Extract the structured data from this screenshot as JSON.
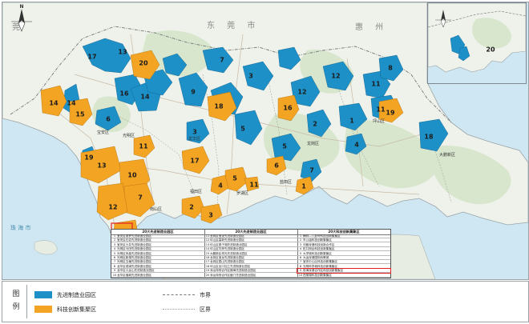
{
  "map": {
    "city_label_left": "深 圳 市",
    "city_label_top_left": "莞",
    "city_label_top_mid": "东 莞 市",
    "city_label_top_right": "惠 州",
    "sea_label": "珠 海 市",
    "north_label": "N",
    "colors": {
      "water": "#cfe7f2",
      "land": "#eef2ea",
      "hill": "#d8e6cd",
      "blue_zone": "#1e90c8",
      "orange_zone": "#f4a423",
      "road": "#c9b9a6",
      "boundary": "#777777"
    }
  },
  "zone_labels": {
    "blue": [
      "13",
      "17",
      "14",
      "16",
      "14",
      "16",
      "18",
      "5",
      "9",
      "3",
      "8",
      "11",
      "12",
      "19",
      "6",
      "7",
      "11",
      "1",
      "5",
      "18",
      "3",
      "12",
      "13",
      "4",
      "2",
      "7"
    ],
    "orange": [
      "20",
      "14",
      "15",
      "18",
      "16",
      "19",
      "13",
      "10",
      "7",
      "12",
      "17",
      "5",
      "4",
      "1",
      "2",
      "3",
      "11",
      "9",
      "6"
    ]
  },
  "inset": {
    "label": "20"
  },
  "place_labels": [
    "宝安区",
    "龙华区",
    "龙岗区",
    "坪山区",
    "大鹏新区",
    "南山区",
    "福田区",
    "罗湖区",
    "盐田区",
    "光明区"
  ],
  "table": {
    "col1_title": "20大先进制造业园区",
    "col2_title": "20大先进制造业园区",
    "col3_title": "20大科技创新集聚区",
    "col1_rows": [
      {
        "n": "1",
        "t": "宝安区燕罗先进制造业园区"
      },
      {
        "n": "2",
        "t": "宝安区石岩先进制造业园区"
      },
      {
        "n": "3",
        "t": "宝安区沙井先进制造业园区"
      },
      {
        "n": "4",
        "t": "光明区马田先进制造业园区"
      },
      {
        "n": "5",
        "t": "光明区凤凰先进制造业园区"
      },
      {
        "n": "6",
        "t": "光明区新湖先进制造业园区"
      },
      {
        "n": "7",
        "t": "光明区玉塘先进制造业园区"
      },
      {
        "n": "8",
        "t": "龙华区观澜先进制造业园区"
      },
      {
        "n": "9",
        "t": "龙华区九龙山先进制造业园区"
      },
      {
        "n": "10",
        "t": "龙华区福城先进制造业园区"
      }
    ],
    "col2_rows": [
      {
        "n": "11",
        "t": "龙岗区宝龙先进制造业园区"
      },
      {
        "n": "12",
        "t": "坪山区高新先进制造业园区"
      },
      {
        "n": "13",
        "t": "坪山区燕子湖先进制造业园区"
      },
      {
        "n": "14",
        "t": "坪山区坑梓先进制造业园区"
      },
      {
        "n": "15",
        "t": "大鹏新区坝光先进制造业园区"
      },
      {
        "n": "16",
        "t": "龙岗区宝龙先进制造业园区"
      },
      {
        "n": "17",
        "t": "龙岗区园山先进制造业园区"
      },
      {
        "n": "18",
        "t": "坪山区出口加工先进制造业园区"
      },
      {
        "n": "19",
        "t": "深汕特别合作区鹅埠先进制造业园区"
      },
      {
        "n": "20",
        "t": "深汕特别合作区鲘门先进制造业园区"
      }
    ],
    "col3_rows": [
      {
        "n": "1",
        "t": "梅林—八卦岭科技创新集聚区"
      },
      {
        "n": "2",
        "t": "车公庙科技创新集聚区"
      },
      {
        "n": "3",
        "t": "河套深港科技创新合作区"
      },
      {
        "n": "4",
        "t": "蛇口网谷科技创新集聚区"
      },
      {
        "n": "5",
        "t": "大学城科技创新集聚区"
      },
      {
        "n": "6",
        "t": "大运深港国际科教城"
      },
      {
        "n": "7",
        "t": "宝安中心区科技创新集聚区"
      },
      {
        "n": "8",
        "t": "光明科学城科技创新集聚区"
      },
      {
        "n": "9",
        "t": "前海深港合作区科技创新集聚区"
      },
      {
        "n": "10",
        "t": "西丽湖科技创新集聚区"
      }
    ]
  },
  "legend": {
    "title": "图例",
    "blue_label": "先进制造业园区",
    "orange_label": "科技创新集聚区",
    "line1_label": "市界",
    "line2_label": "区界"
  }
}
